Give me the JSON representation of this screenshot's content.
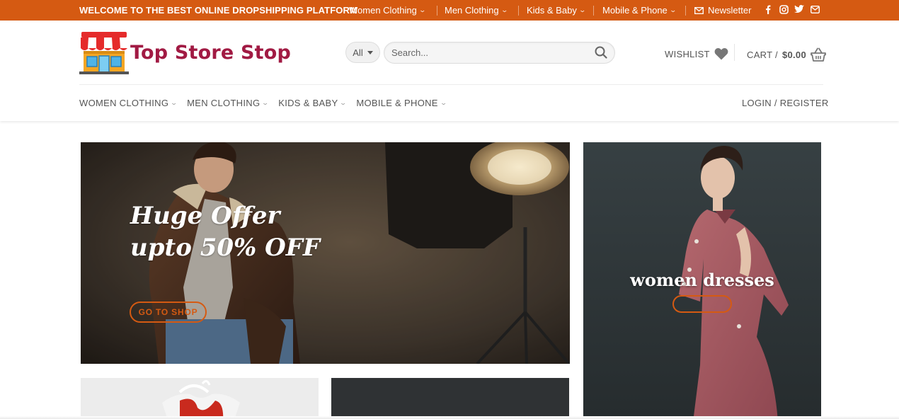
{
  "topbar": {
    "welcome": "WELCOME TO THE BEST ONLINE DROPSHIPPING PLATFORM",
    "links": [
      "Women Clothing",
      "Men Clothing",
      "Kids & Baby",
      "Mobile & Phone"
    ],
    "newsletter": "Newsletter",
    "social_icons": [
      "facebook-icon",
      "instagram-icon",
      "twitter-icon",
      "envelope-icon"
    ],
    "bg_color": "#d55a12"
  },
  "header": {
    "logo_text": "Top Store Stop",
    "logo_color": "#a11a43",
    "category_select": "All",
    "search_placeholder": "Search...",
    "wishlist_label": "WISHLIST",
    "cart_label": "CART /",
    "cart_amount": "$0.00"
  },
  "nav": {
    "items": [
      "WOMEN CLOTHING",
      "MEN CLOTHING",
      "KIDS & BABY",
      "MOBILE & PHONE"
    ],
    "login": "LOGIN / REGISTER"
  },
  "banners": {
    "main": {
      "line1": "Huge Offer",
      "line2": "upto 50% OFF",
      "button": "GO TO SHOP"
    },
    "side": {
      "title": "women dresses",
      "button": ""
    }
  },
  "accent_color": "#d55a12"
}
